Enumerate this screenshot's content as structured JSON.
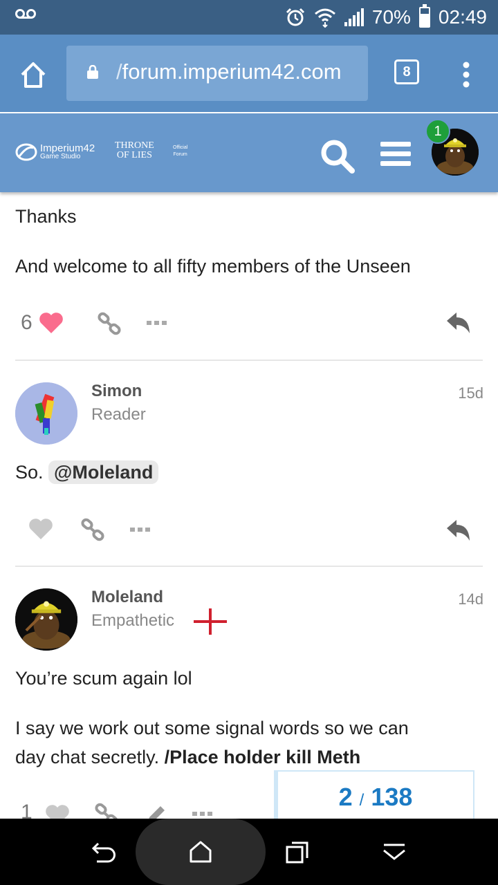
{
  "status_bar": {
    "battery": "70%",
    "battery_level": 0.7,
    "time": "02:49"
  },
  "browser": {
    "url_prefix": "/",
    "url": "forum.imperium42.com",
    "tab_count": "8"
  },
  "forum_header": {
    "logo_name": "Imperium42",
    "logo_sub": "Game Studio",
    "logo2_line1": "THRONE",
    "logo2_line2": "OF LIES",
    "logo3_line1": "Official",
    "logo3_line2": "Forum",
    "notification_count": "1"
  },
  "posts": {
    "prev": {
      "line1": "Thanks",
      "line2": "And welcome to all fifty members of the Unseen",
      "like_count": "6"
    },
    "simon": {
      "username": "Simon",
      "title": "Reader",
      "date": "15d",
      "text": "So.",
      "mention": "@Moleland"
    },
    "moleland": {
      "username": "Moleland",
      "title": "Empathetic",
      "date": "14d",
      "line1": "You’re scum again lol",
      "line2": "I say we work out some signal words so we can",
      "line3a": "day chat secretly.",
      "line3b": "/Place holder kill Meth",
      "like_count": "1"
    }
  },
  "progress": {
    "current": "2",
    "separator": "/",
    "total": "138"
  },
  "colors": {
    "status_bar": "#3a5f84",
    "browser_bar": "#5a8ec4",
    "forum_header": "#6898cc",
    "like_active": "#fa6c8d",
    "progress_text": "#1b7ac3",
    "badge": "#1e9f3a",
    "flair": "#d0202e"
  }
}
